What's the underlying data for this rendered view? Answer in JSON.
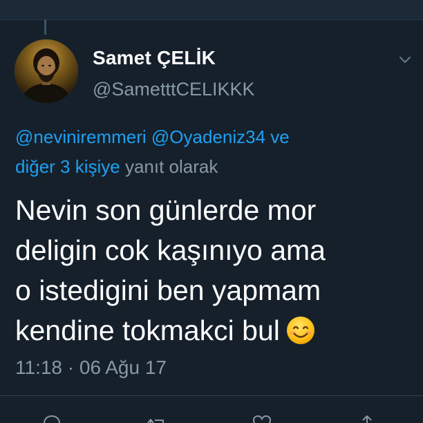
{
  "tweet": {
    "display_name": "Samet ÇELİK",
    "handle": "@SametttCELIKKK",
    "reply_context": {
      "mention_1": "@neviniremmeri",
      "mention_2": "@Oyadeniz34",
      "connector": "ve",
      "others": "diğer 3 kişiye",
      "suffix": "yanıt olarak"
    },
    "body_lines": [
      "Nevin son günlerde mor",
      "deligin cok kaşınıyo ama",
      "o istedigini ben yapmam",
      "kendine tokmakci bul"
    ],
    "emoji": "smiling-face-icon",
    "timestamp": "11:18 · 06 Ağu 17"
  },
  "icons": {
    "chevron": "chevron-down-icon",
    "actions": [
      "reply-icon",
      "retweet-icon",
      "like-icon",
      "share-icon"
    ]
  },
  "colors": {
    "background": "#15202b",
    "text_primary": "#ffffff",
    "text_secondary": "#8899a6",
    "link": "#1da1f2",
    "divider": "#38444d"
  }
}
